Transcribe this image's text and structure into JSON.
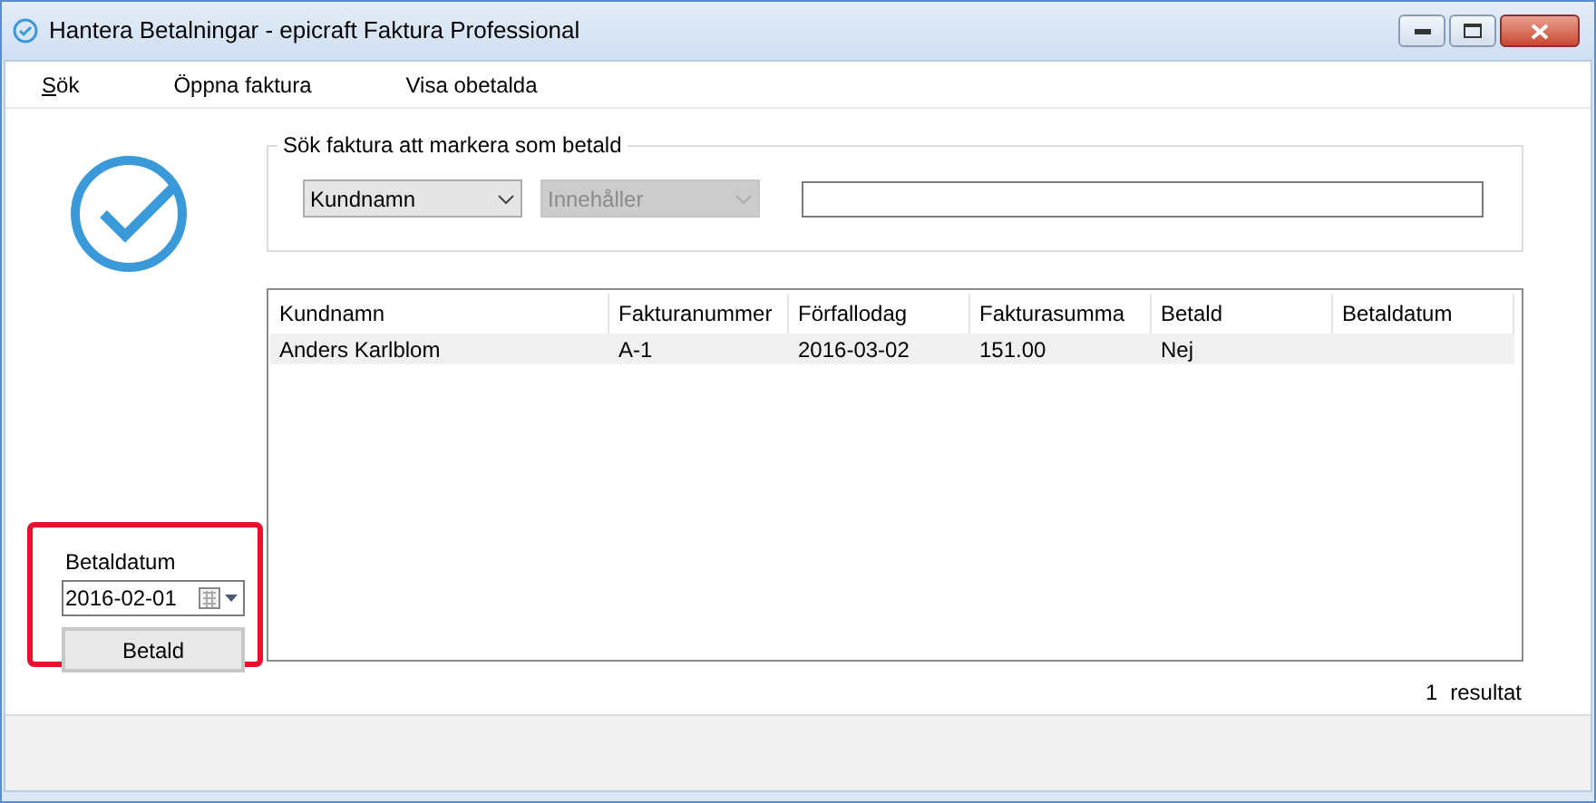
{
  "window": {
    "title": "Hantera Betalningar - epicraft Faktura Professional"
  },
  "menu": [
    {
      "label": "Sök",
      "underline_first": true
    },
    {
      "label": "Öppna faktura",
      "underline_first": false
    },
    {
      "label": "Visa obetalda",
      "underline_first": false
    }
  ],
  "search": {
    "legend": "Sök faktura att markera som betald",
    "field_dropdown": {
      "value": "Kundnamn",
      "disabled": false
    },
    "operator_dropdown": {
      "value": "Innehåller",
      "disabled": true
    }
  },
  "table": {
    "columns": [
      "Kundnamn",
      "Fakturanummer",
      "Förfallodag",
      "Fakturasumma",
      "Betald",
      "Betaldatum"
    ],
    "rows": [
      [
        "Anders Karlblom",
        "A-1",
        "2016-03-02",
        "151.00",
        "Nej",
        ""
      ]
    ]
  },
  "pay_panel": {
    "highlighted": true,
    "label": "Betaldatum",
    "date": "2016-02-01",
    "button": "Betald"
  },
  "result_count": {
    "number": "1",
    "label": "resultat"
  }
}
